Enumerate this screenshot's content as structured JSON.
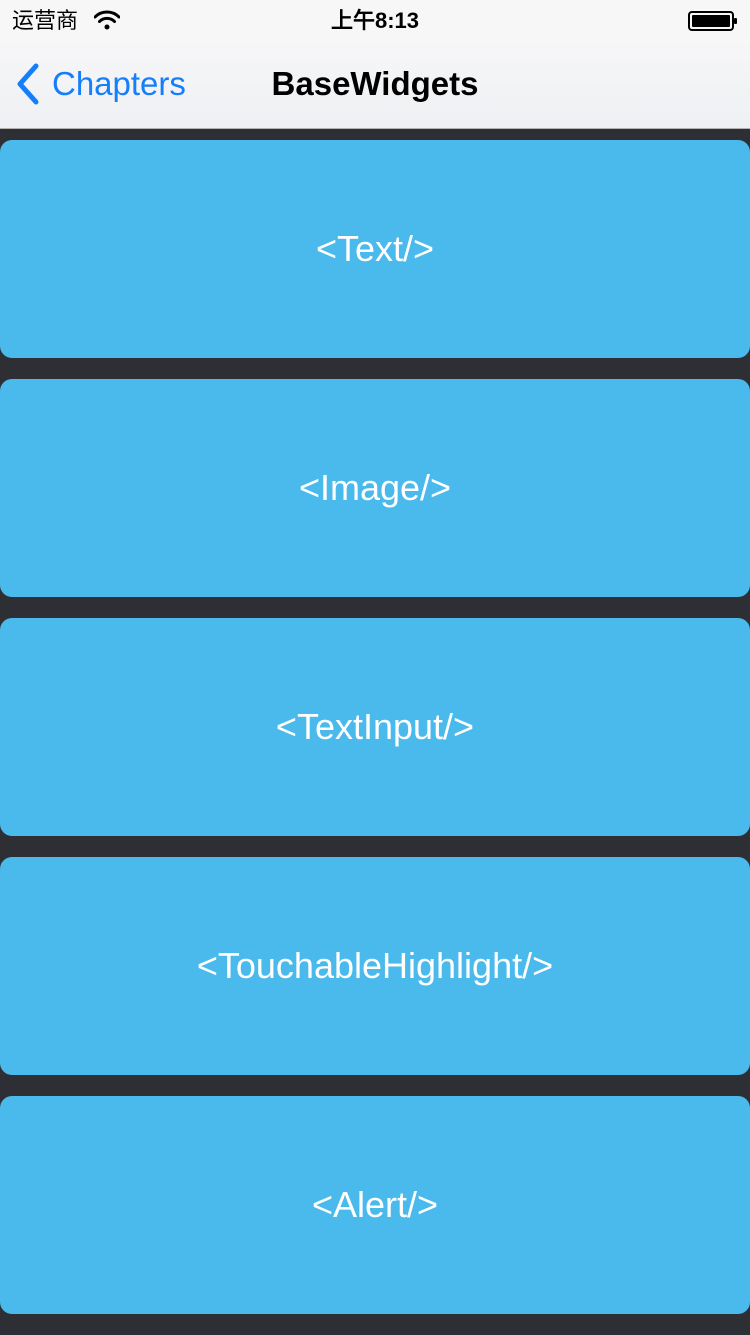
{
  "status_bar": {
    "carrier": "运营商",
    "time": "上午8:13",
    "wifi_icon": "wifi-icon",
    "battery_icon": "battery-icon"
  },
  "nav_bar": {
    "back_label": "Chapters",
    "back_icon": "chevron-left-icon",
    "title": "BaseWidgets"
  },
  "colors": {
    "accent": "#157efb",
    "card": "#4ab9ec",
    "background": "#2d2f35",
    "card_text": "#ffffff"
  },
  "widgets": [
    {
      "label": "<Text/>"
    },
    {
      "label": "<Image/>"
    },
    {
      "label": "<TextInput/>"
    },
    {
      "label": "<TouchableHighlight/>"
    },
    {
      "label": "<Alert/>"
    }
  ]
}
